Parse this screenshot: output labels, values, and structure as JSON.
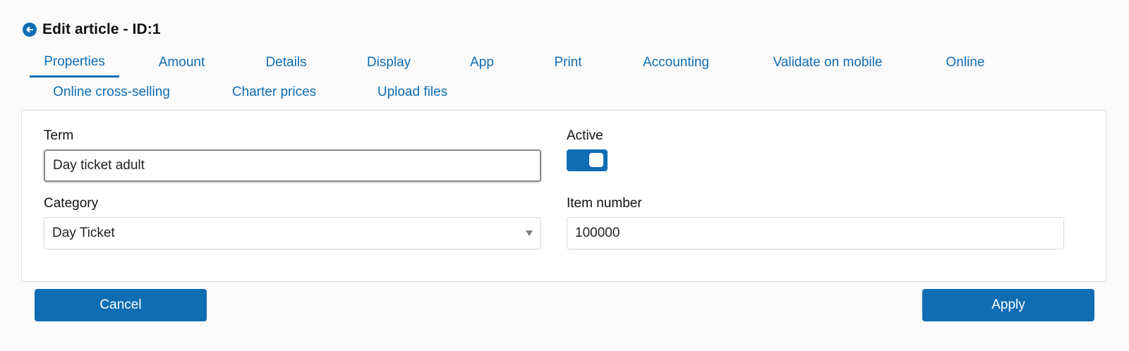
{
  "header": {
    "icon": "arrow-left-circle-icon",
    "title": "Edit article - ID:1"
  },
  "tabs": {
    "active_index": 0,
    "row1": [
      "Properties",
      "Amount",
      "Details",
      "Display",
      "App",
      "Print",
      "Accounting",
      "Validate on mobile",
      "Online"
    ],
    "row2": [
      "Online cross-selling",
      "Charter prices",
      "Upload files"
    ]
  },
  "form": {
    "term": {
      "label": "Term",
      "value": "Day ticket adult"
    },
    "active": {
      "label": "Active",
      "checked": true
    },
    "category": {
      "label": "Category",
      "value": "Day Ticket"
    },
    "item_number": {
      "label": "Item number",
      "value": "100000"
    }
  },
  "actions": {
    "cancel_label": "Cancel",
    "apply_label": "Apply"
  },
  "colors": {
    "accent": "#0f6db3",
    "background": "#fafafa",
    "panel": "#ffffff"
  }
}
